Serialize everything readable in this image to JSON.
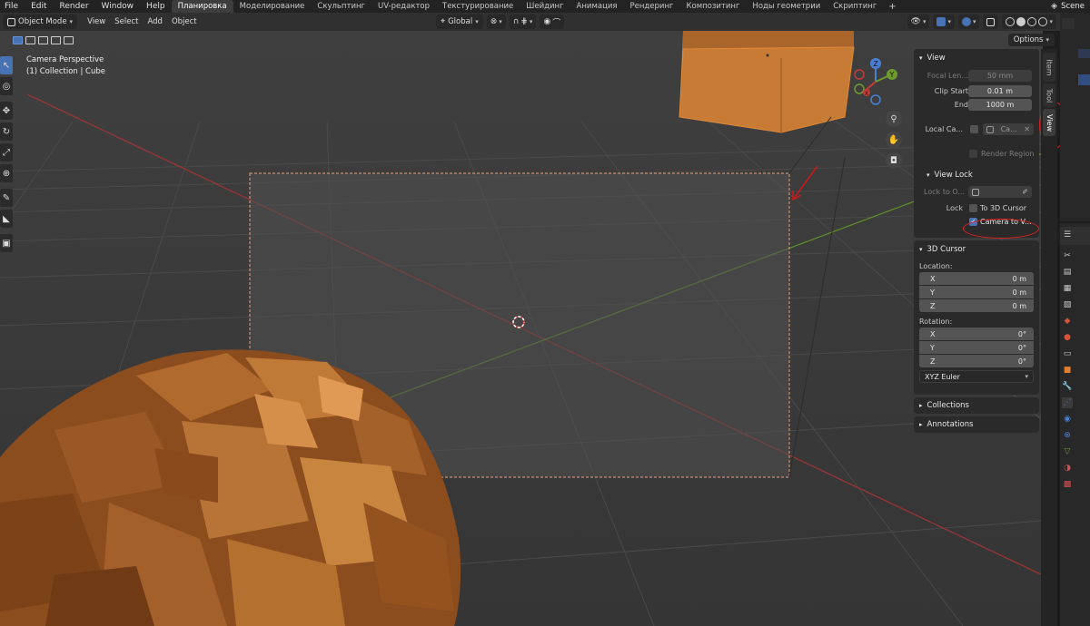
{
  "topbar": {
    "menus": [
      "File",
      "Edit",
      "Render",
      "Window",
      "Help"
    ],
    "workspaces": [
      "Планировка",
      "Моделирование",
      "Скульптинг",
      "UV-редактор",
      "Текстурирование",
      "Шейдинг",
      "Анимация",
      "Рендеринг",
      "Композитинг",
      "Ноды геометрии",
      "Скриптинг"
    ],
    "active_workspace": "Планировка",
    "add_workspace": "+",
    "scene": "Scene"
  },
  "header": {
    "mode": "Object Mode",
    "menus": [
      "View",
      "Select",
      "Add",
      "Object"
    ],
    "orientation": "Global"
  },
  "subheader": {
    "options": "Options"
  },
  "viewport": {
    "camera_label": "Camera Perspective",
    "collection_label": "(1) Collection | Cube"
  },
  "gizmo": {
    "x": "X",
    "y": "Y",
    "z": "Z"
  },
  "sidebar_tabs": [
    "Item",
    "Tool",
    "View"
  ],
  "active_sidebar_tab": "View",
  "npanel": {
    "view": {
      "title": "View",
      "focal_length_label": "Focal Len...",
      "focal_length_value": "50 mm",
      "clip_start_label": "Clip Start",
      "clip_start_value": "0.01 m",
      "clip_end_label": "End",
      "clip_end_value": "1000 m",
      "local_camera_label": "Local Ca...",
      "local_camera_value": "Ca...",
      "render_region_label": "Render Region"
    },
    "view_lock": {
      "title": "View Lock",
      "lock_to_object_label": "Lock to O...",
      "lock_label": "Lock",
      "to_3d_cursor_label": "To 3D Cursor",
      "camera_to_view_label": "Camera to V..."
    },
    "cursor": {
      "title": "3D Cursor",
      "location_label": "Location:",
      "location": [
        {
          "axis": "X",
          "value": "0 m"
        },
        {
          "axis": "Y",
          "value": "0 m"
        },
        {
          "axis": "Z",
          "value": "0 m"
        }
      ],
      "rotation_label": "Rotation:",
      "rotation": [
        {
          "axis": "X",
          "value": "0°"
        },
        {
          "axis": "Y",
          "value": "0°"
        },
        {
          "axis": "Z",
          "value": "0°"
        }
      ],
      "rotation_mode": "XYZ Euler"
    },
    "collections": {
      "title": "Collections"
    },
    "annotations": {
      "title": "Annotations"
    }
  },
  "colors": {
    "accent": "#4772b3",
    "object_orange": "#b96a2a",
    "x_axis": "#c83a3a",
    "y_axis": "#6e9a2e",
    "z_axis": "#4a80d4",
    "annotation_red": "#e02020"
  }
}
